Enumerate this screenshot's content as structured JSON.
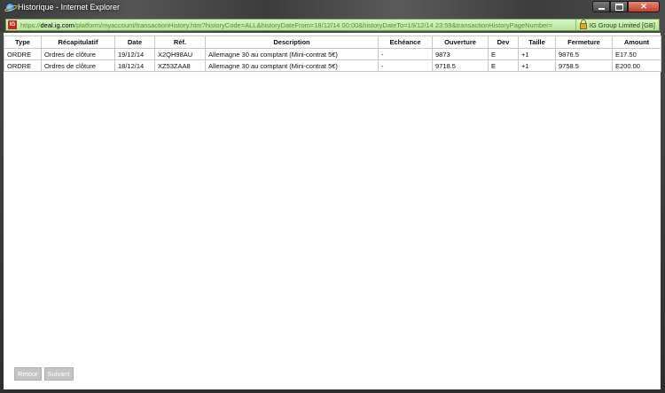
{
  "window": {
    "title": "Historique - Internet Explorer"
  },
  "address": {
    "prefix": "https://",
    "host": "deal.ig.com",
    "path": "/platform/myaccount/transactionHistory.htm?historyCode=ALL&historyDateFrom=18/12/14 00:00&historyDateTo=19/12/14 23:59&transactionHistoryPageNumber=",
    "security_label": "IG Group Limited [GB]",
    "site_logo": "IG"
  },
  "table": {
    "headers": [
      "Type",
      "Récapitulatif",
      "Date",
      "Réf.",
      "Description",
      "Echéance",
      "Ouverture",
      "Dev",
      "Taille",
      "Fermeture",
      "Amount"
    ],
    "rows": [
      [
        "ORDRE",
        "Ordres de clôture",
        "19/12/14",
        "X2QH98AU",
        "Allemagne 30 au comptant (Mini-contrat 5€)",
        "-",
        "9873",
        "E",
        "+1",
        "9876.5",
        "E17.50"
      ],
      [
        "ORDRE",
        "Ordres de clôture",
        "18/12/14",
        "XZ53ZAA8",
        "Allemagne 30 au comptant (Mini-contrat 5€)",
        "-",
        "9718.5",
        "E",
        "+1",
        "9758.5",
        "E200.00"
      ]
    ]
  },
  "pager": {
    "prev_label": "Retour",
    "next_label": "Suivant"
  },
  "colors": {
    "address_bg": "#c6ebb0",
    "close_button": "#c1402b",
    "disabled_button": "#c4c4c4"
  }
}
